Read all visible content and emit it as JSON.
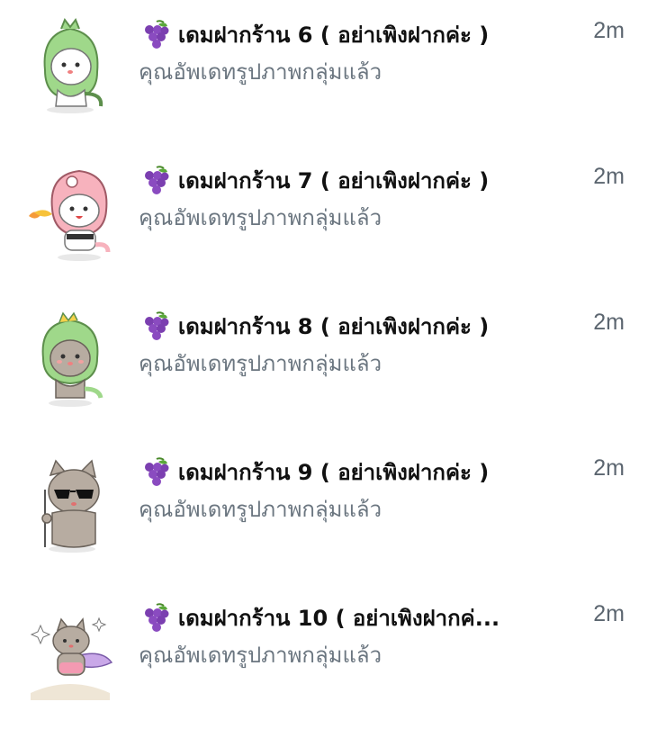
{
  "chats": [
    {
      "avatar_icon": "dino-bunny-sticker-icon",
      "group_icon": "grapes-icon",
      "title": "เดมฝากร้าน 6 ( อย่าเพิงฝากค่ะ )",
      "time": "2m",
      "message": "คุณอัพเดทรูปภาพกลุ่มแล้ว"
    },
    {
      "avatar_icon": "pink-dino-bear-sticker-icon",
      "group_icon": "grapes-icon",
      "title": "เดมฝากร้าน 7 ( อย่าเพิงฝากค่ะ )",
      "time": "2m",
      "message": "คุณอัพเดทรูปภาพกลุ่มแล้ว"
    },
    {
      "avatar_icon": "dino-cat-sticker-icon",
      "group_icon": "grapes-icon",
      "title": "เดมฝากร้าน 8 ( อย่าเพิงฝากค่ะ )",
      "time": "2m",
      "message": "คุณอัพเดทรูปภาพกลุ่มแล้ว"
    },
    {
      "avatar_icon": "sunglasses-cat-sticker-icon",
      "group_icon": "grapes-icon",
      "title": "เดมฝากร้าน 9 ( อย่าเพิงฝากค่ะ )",
      "time": "2m",
      "message": "คุณอัพเดทรูปภาพกลุ่มแล้ว"
    },
    {
      "avatar_icon": "hero-cat-sticker-icon",
      "group_icon": "grapes-icon",
      "title": "เดมฝากร้าน 10 ( อย่าเพิงฝากค่...",
      "time": "2m",
      "message": "คุณอัพเดทรูปภาพกลุ่มแล้ว"
    }
  ],
  "colors": {
    "title": "#111111",
    "message": "#6b7680",
    "time": "#5c6670",
    "grape": "#7b3fb0"
  }
}
